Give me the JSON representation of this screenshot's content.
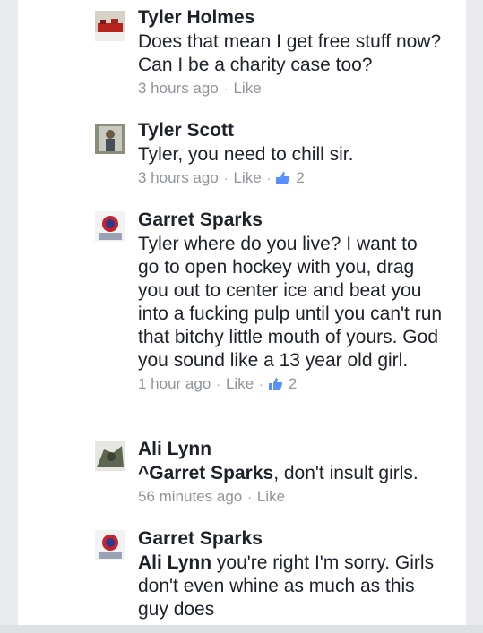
{
  "comments": [
    {
      "author": "Tyler Holmes",
      "text": "Does that mean I get free stuff now? Can I be a charity case too?",
      "time": "3 hours ago",
      "like": "Like",
      "likes": ""
    },
    {
      "author": "Tyler Scott",
      "text": "Tyler, you need to chill sir.",
      "time": "3 hours ago",
      "like": "Like",
      "likes": "2"
    },
    {
      "author": "Garret Sparks",
      "text": "Tyler where do you live? I want to go to open hockey with you, drag you out to center ice and beat you into a fucking pulp until you can't run that bitchy little mouth of yours. God you sound like a 13 year old girl.",
      "time": "1 hour ago",
      "like": "Like",
      "likes": "2"
    },
    {
      "author": "Ali Lynn",
      "mention": "^Garret Sparks",
      "text": ", don't insult girls.",
      "time": "56 minutes ago",
      "like": "Like",
      "likes": ""
    },
    {
      "author": "Garret Sparks",
      "mention": "Ali Lynn",
      "text": " you're right I'm sorry. Girls don't even whine as much as this guy does",
      "time": "",
      "like": "",
      "likes": ""
    }
  ],
  "icons": {
    "thumb": "thumbs-up-icon",
    "dot": "·"
  },
  "colors": {
    "text": "#1d2129",
    "meta": "#90949c",
    "like_badge": "#5890ff"
  }
}
